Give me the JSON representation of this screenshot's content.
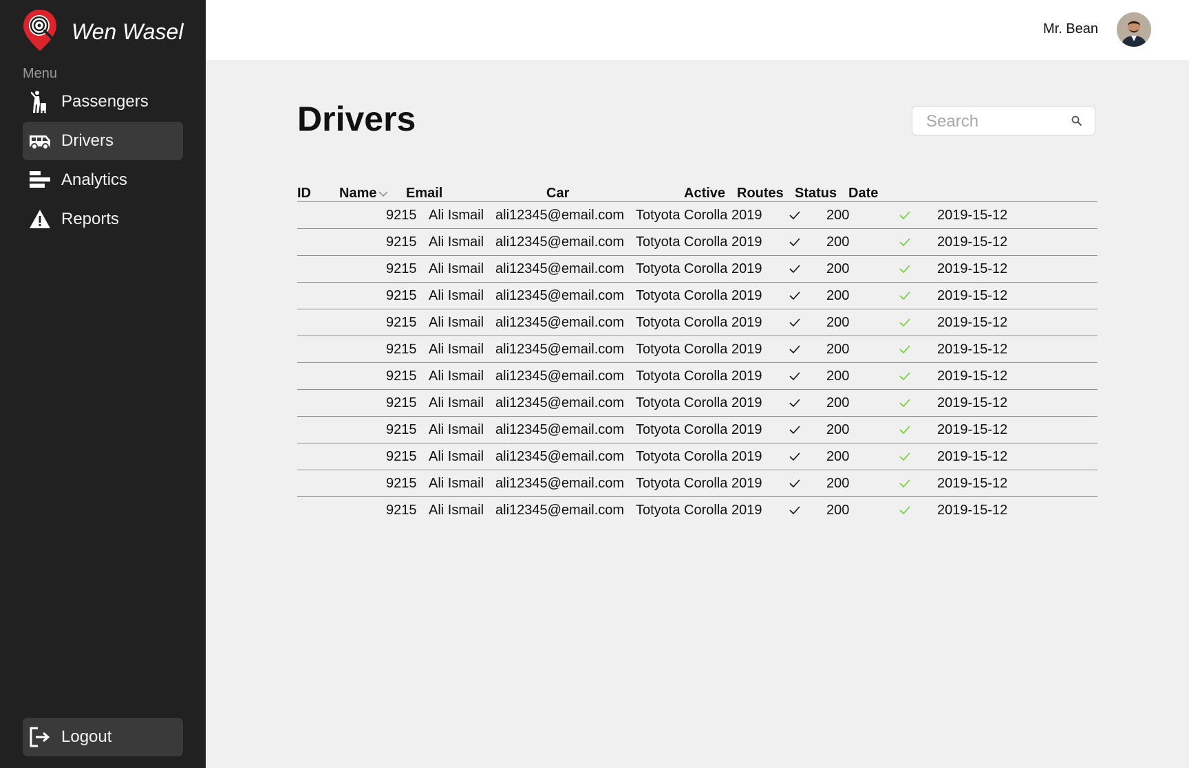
{
  "app": {
    "name": "Wen Wasel"
  },
  "sidebar": {
    "menu_label": "Menu",
    "items": [
      {
        "label": "Passengers",
        "icon": "passenger-icon",
        "active": false
      },
      {
        "label": "Drivers",
        "icon": "van-icon",
        "active": true
      },
      {
        "label": "Analytics",
        "icon": "bar-chart-icon",
        "active": false
      },
      {
        "label": "Reports",
        "icon": "warning-icon",
        "active": false
      }
    ],
    "logout_label": "Logout"
  },
  "header": {
    "user_name": "Mr. Bean"
  },
  "main": {
    "title": "Drivers",
    "search": {
      "placeholder": "Search",
      "value": ""
    },
    "table": {
      "columns": [
        "ID",
        "Name",
        "Email",
        "Car",
        "Active",
        "Routes",
        "Status",
        "Date"
      ],
      "sort_column": "Name",
      "rows": [
        {
          "id": "9215",
          "name": "Ali Ismail",
          "email": "ali12345@email.com",
          "car": "Totyota Corolla 2019",
          "active": true,
          "routes": "200",
          "status": true,
          "date": "2019-15-12"
        },
        {
          "id": "9215",
          "name": "Ali Ismail",
          "email": "ali12345@email.com",
          "car": "Totyota Corolla 2019",
          "active": true,
          "routes": "200",
          "status": true,
          "date": "2019-15-12"
        },
        {
          "id": "9215",
          "name": "Ali Ismail",
          "email": "ali12345@email.com",
          "car": "Totyota Corolla 2019",
          "active": true,
          "routes": "200",
          "status": true,
          "date": "2019-15-12"
        },
        {
          "id": "9215",
          "name": "Ali Ismail",
          "email": "ali12345@email.com",
          "car": "Totyota Corolla 2019",
          "active": true,
          "routes": "200",
          "status": true,
          "date": "2019-15-12"
        },
        {
          "id": "9215",
          "name": "Ali Ismail",
          "email": "ali12345@email.com",
          "car": "Totyota Corolla 2019",
          "active": true,
          "routes": "200",
          "status": true,
          "date": "2019-15-12"
        },
        {
          "id": "9215",
          "name": "Ali Ismail",
          "email": "ali12345@email.com",
          "car": "Totyota Corolla 2019",
          "active": true,
          "routes": "200",
          "status": true,
          "date": "2019-15-12"
        },
        {
          "id": "9215",
          "name": "Ali Ismail",
          "email": "ali12345@email.com",
          "car": "Totyota Corolla 2019",
          "active": true,
          "routes": "200",
          "status": true,
          "date": "2019-15-12"
        },
        {
          "id": "9215",
          "name": "Ali Ismail",
          "email": "ali12345@email.com",
          "car": "Totyota Corolla 2019",
          "active": true,
          "routes": "200",
          "status": true,
          "date": "2019-15-12"
        },
        {
          "id": "9215",
          "name": "Ali Ismail",
          "email": "ali12345@email.com",
          "car": "Totyota Corolla 2019",
          "active": true,
          "routes": "200",
          "status": true,
          "date": "2019-15-12"
        },
        {
          "id": "9215",
          "name": "Ali Ismail",
          "email": "ali12345@email.com",
          "car": "Totyota Corolla 2019",
          "active": true,
          "routes": "200",
          "status": true,
          "date": "2019-15-12"
        },
        {
          "id": "9215",
          "name": "Ali Ismail",
          "email": "ali12345@email.com",
          "car": "Totyota Corolla 2019",
          "active": true,
          "routes": "200",
          "status": true,
          "date": "2019-15-12"
        },
        {
          "id": "9215",
          "name": "Ali Ismail",
          "email": "ali12345@email.com",
          "car": "Totyota Corolla 2019",
          "active": true,
          "routes": "200",
          "status": true,
          "date": "2019-15-12"
        }
      ]
    }
  },
  "colors": {
    "sidebar_bg": "#212121",
    "active_item_bg": "#3a3a3a",
    "brand_red": "#d9252b",
    "status_green": "#6ccf2e",
    "page_bg": "#f0f0f0"
  }
}
